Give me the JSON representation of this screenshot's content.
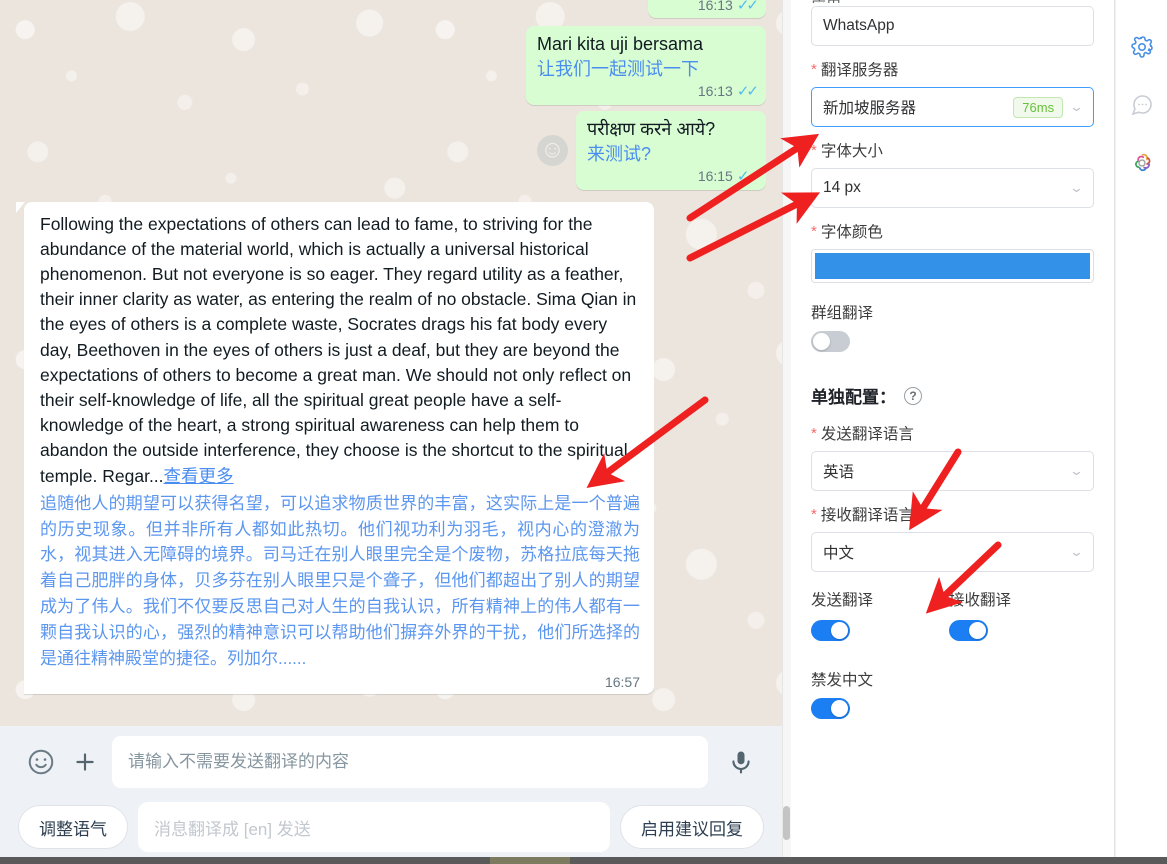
{
  "chat": {
    "partial_bubble": {
      "time": "16:13",
      "ticks": "✓✓"
    },
    "messages": [
      {
        "text": "Mari kita uji bersama",
        "translation": "让我们一起测试一下",
        "time": "16:13",
        "ticks": "✓✓"
      },
      {
        "text": "परीक्षण करने आये?",
        "translation": "来测试?",
        "time": "16:15",
        "ticks": "✓✓",
        "avatar_icon": "smiley-face-icon"
      }
    ],
    "long_message": {
      "english": "Following the expectations of others can lead to fame, to striving for the abundance of the material world, which is actually a universal historical phenomenon. But not everyone is so eager. They regard utility as a feather, their inner clarity as water, as entering the realm of no obstacle. Sima Qian in the eyes of others is a complete waste, Socrates drags his fat body every day, Beethoven in the eyes of others is just a deaf, but they are beyond the expectations of others to become a great man. We should not only reflect on their self-knowledge of life, all the spiritual great people have a self-knowledge of the heart, a strong spiritual awareness can help them to abandon the outside interference, they choose is the shortcut to the spiritual temple. Regar...",
      "more_label": "查看更多",
      "chinese": "追随他人的期望可以获得名望，可以追求物质世界的丰富，这实际上是一个普遍的历史现象。但并非所有人都如此热切。他们视功利为羽毛，视内心的澄澈为水，视其进入无障碍的境界。司马迁在别人眼里完全是个废物，苏格拉底每天拖着自己肥胖的身体，贝多芬在别人眼里只是个聋子，但他们都超出了别人的期望成为了伟人。我们不仅要反思自己对人生的自我认识，所有精神上的伟人都有一颗自我认识的心，强烈的精神意识可以帮助他们摒弃外界的干扰，他们所选择的是通往精神殿堂的捷径。列加尔......",
      "time": "16:57"
    }
  },
  "composer": {
    "emoji_icon": "smiley-face-icon",
    "attach_icon": "plus-icon",
    "mic_icon": "microphone-icon",
    "input_value": "",
    "input_placeholder": "请输入不需要发送翻译的内容",
    "tone_button": "调整语气",
    "translate_hint": "消息翻译成 [en] 发送",
    "suggest_button": "启用建议回复"
  },
  "settings": {
    "app_field": {
      "label_partial": "应用",
      "value": "WhatsApp"
    },
    "server_field": {
      "label": "翻译服务器",
      "required": true,
      "value": "新加坡服务器",
      "latency": "76ms",
      "focused": true
    },
    "font_size_field": {
      "label": "字体大小",
      "required": true,
      "value": "14 px"
    },
    "font_color_field": {
      "label": "字体颜色",
      "required": true,
      "color": "#3391e8"
    },
    "group_translate": {
      "label": "群组翻译",
      "on": false
    },
    "section": {
      "title": "单独配置：",
      "help_icon": "question-mark-icon"
    },
    "send_lang_field": {
      "label": "发送翻译语言",
      "required": true,
      "value": "英语"
    },
    "recv_lang_field": {
      "label": "接收翻译语言",
      "required": true,
      "value": "中文"
    },
    "send_translate": {
      "label": "发送翻译",
      "on": true
    },
    "recv_translate": {
      "label": "接收翻译",
      "on": true
    },
    "ban_chinese": {
      "label": "禁发中文",
      "on": true
    }
  },
  "rail": {
    "items": [
      {
        "icon": "gear-icon",
        "color": "#4a90e2"
      },
      {
        "icon": "chat-bubble-icon",
        "color": "#c8cdd4"
      },
      {
        "icon": "openai-logo-icon",
        "color": "#7a7a7a"
      }
    ]
  },
  "theme": {
    "accent_blue": "#1c7ef3",
    "translation_blue": "#5b96ef",
    "bubble_green": "#d9fdd3",
    "chat_bg": "#ece5dd",
    "arrow_red": "#ef2020"
  }
}
